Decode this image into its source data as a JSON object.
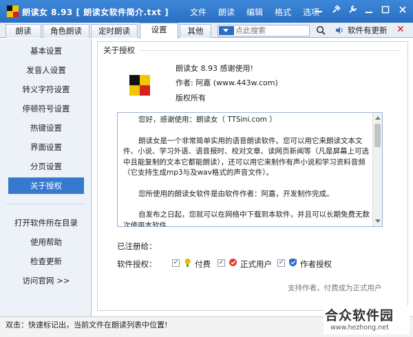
{
  "titlebar": {
    "title": "朗读女 8.93  [ 朗读女软件简介.txt ]",
    "menu": [
      "文件",
      "朗读",
      "编辑",
      "格式",
      "选项"
    ]
  },
  "tabs": [
    {
      "label": "朗读"
    },
    {
      "label": "角色朗读"
    },
    {
      "label": "定时朗读"
    },
    {
      "label": "设置",
      "active": true
    },
    {
      "label": "其他"
    }
  ],
  "search": {
    "placeholder": "点此搜索"
  },
  "update_label": "软件有更新",
  "sidebar": {
    "items": [
      {
        "label": "基本设置"
      },
      {
        "label": "发音人设置"
      },
      {
        "label": "转义字符设置"
      },
      {
        "label": "停顿符号设置"
      },
      {
        "label": "热键设置"
      },
      {
        "label": "界面设置"
      },
      {
        "label": "分页设置"
      },
      {
        "label": "关于授权",
        "active": true
      }
    ],
    "links": [
      {
        "label": "打开软件所在目录"
      },
      {
        "label": "使用帮助"
      },
      {
        "label": "检查更新"
      },
      {
        "label": "访问官网 >>"
      }
    ]
  },
  "about": {
    "section_title": "关于授权",
    "line1": "朗读女 8.93 感谢使用!",
    "line2": "作者: 阿嘉 (www.443w.com)",
    "line3": "版权所有",
    "text": [
      "您好，感谢使用：朗读女（ TTSini.com ）",
      "朗读女是一个非常简单实用的语音朗读软件。您可以用它来朗读文本文件、小说、学习外语、语音报时、校对文章、读网页新闻等（凡是屏幕上可选中且能复制的文本它都能朗读），还可以用它来制作有声小说和学习资料音频（它支持生成mp3与及wav格式的声音文件）。",
      "您所使用的朗读女软件是由软件作者：阿嘉，开发制作完成。",
      "自发布之日起，您就可以在网络中下载到本软件，并且可以长期免费无数次使用本软件。"
    ],
    "registered_to": "已注册给：",
    "license_label": "软件授权：",
    "licenses": [
      {
        "label": "付费",
        "checked": true
      },
      {
        "label": "正式用户",
        "checked": true
      },
      {
        "label": "作者授权",
        "checked": true
      }
    ],
    "support_text": "支持作者，付费成为正式用户"
  },
  "status": "双击：快速标记出，当前文件在朗读列表中位置!",
  "watermark": {
    "name": "合众软件园",
    "url": "www.hezhong.net"
  },
  "colors": {
    "titlebar": "#2f78cc",
    "accent": "#3579d0",
    "logo_yellow": "#f2c500",
    "logo_red": "#d42020"
  }
}
